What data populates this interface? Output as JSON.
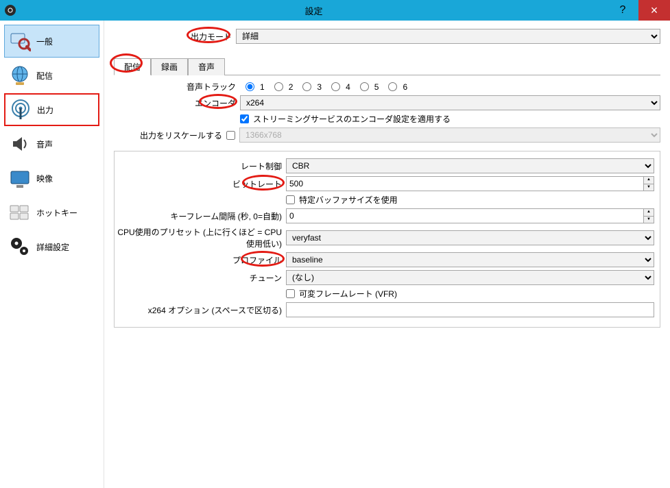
{
  "window": {
    "title": "設定"
  },
  "sidebar": {
    "items": [
      {
        "label": "一般"
      },
      {
        "label": "配信"
      },
      {
        "label": "出力"
      },
      {
        "label": "音声"
      },
      {
        "label": "映像"
      },
      {
        "label": "ホットキー"
      },
      {
        "label": "詳細設定"
      }
    ]
  },
  "output_mode": {
    "label": "出力モード",
    "value": "詳細"
  },
  "tabs": {
    "stream": "配信",
    "record": "録画",
    "audio": "音声"
  },
  "stream": {
    "audio_track_label": "音声トラック",
    "tracks": [
      "1",
      "2",
      "3",
      "4",
      "5",
      "6"
    ],
    "encoder_label": "エンコーダ",
    "encoder_value": "x264",
    "enforce_label": "ストリーミングサービスのエンコーダ設定を適用する",
    "rescale_label": "出力をリスケールする",
    "rescale_value": "1366x768",
    "rate_control_label": "レート制御",
    "rate_control_value": "CBR",
    "bitrate_label": "ビットレート",
    "bitrate_value": "500",
    "buffer_label": "特定バッファサイズを使用",
    "keyframe_label": "キーフレーム間隔 (秒, 0=自動)",
    "keyframe_value": "0",
    "preset_label": "CPU使用のプリセット (上に行くほど = CPU使用低い)",
    "preset_value": "veryfast",
    "profile_label": "プロファイル",
    "profile_value": "baseline",
    "tune_label": "チューン",
    "tune_value": "(なし)",
    "vfr_label": "可変フレームレート (VFR)",
    "x264opts_label": "x264 オプション (スペースで区切る)",
    "x264opts_value": ""
  }
}
